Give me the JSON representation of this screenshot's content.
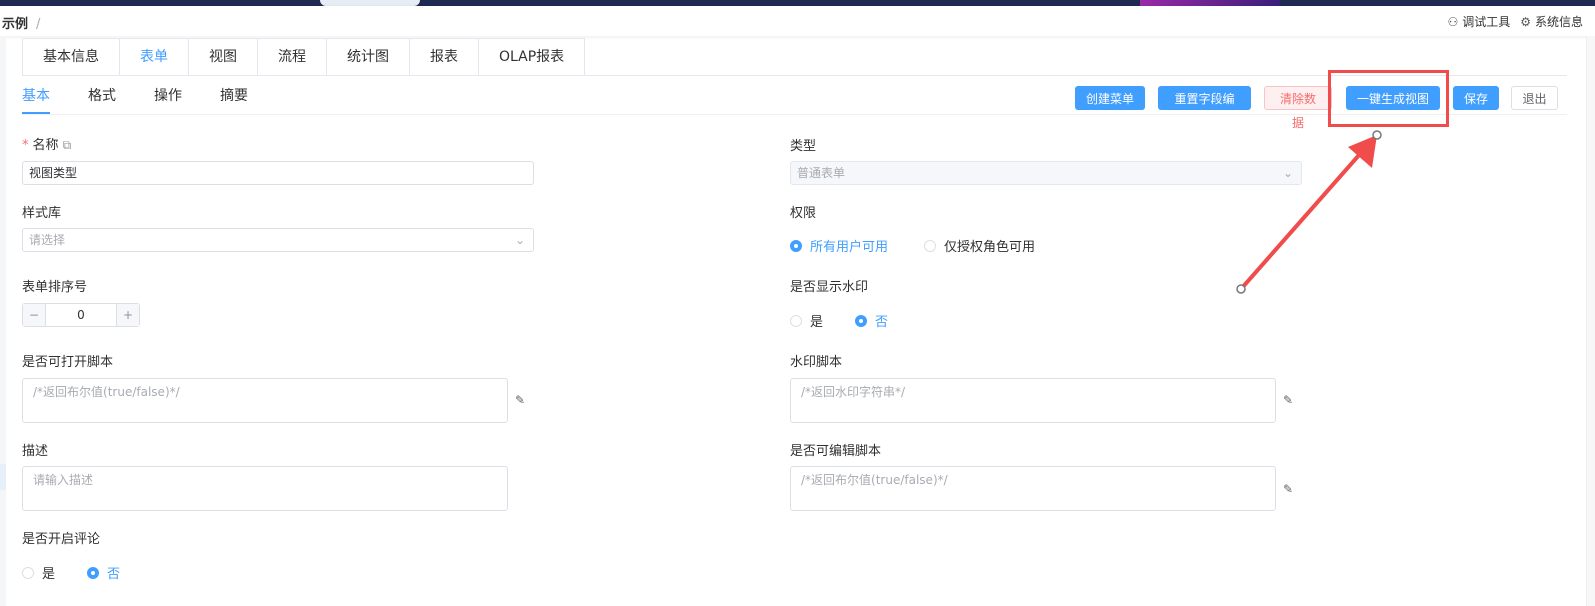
{
  "header": {
    "breadcrumb": "示例",
    "breadcrumb_sep": "/",
    "tools": [
      {
        "icon": "debug-icon",
        "label": "调试工具"
      },
      {
        "icon": "gear-icon",
        "label": "系统信息"
      }
    ]
  },
  "tabs_main": [
    "基本信息",
    "表单",
    "视图",
    "流程",
    "统计图",
    "报表",
    "OLAP报表"
  ],
  "tabs_main_active": "表单",
  "tabs_sub": [
    "基本",
    "格式",
    "操作",
    "摘要"
  ],
  "tabs_sub_active": "基本",
  "buttons": {
    "create_menu": "创建菜单",
    "reset_field_no": "重置字段编号",
    "clear_data": "清除数据",
    "generate_view": "一键生成视图",
    "save": "保存",
    "exit": "退出"
  },
  "form": {
    "name_label": "名称",
    "name_value": "视图类型",
    "style_lib_label": "样式库",
    "style_lib_placeholder": "请选择",
    "sort_label": "表单排序号",
    "sort_value": "0",
    "open_script_label": "是否可打开脚本",
    "open_script_placeholder": "/*返回布尔值(true/false)*/",
    "desc_label": "描述",
    "desc_placeholder": "请输入描述",
    "comment_label": "是否开启评论",
    "comment_options": [
      "是",
      "否"
    ],
    "comment_selected": "否",
    "type_label": "类型",
    "type_value": "普通表单",
    "perm_label": "权限",
    "perm_options": [
      "所有用户可用",
      "仅授权角色可用"
    ],
    "perm_selected": "所有用户可用",
    "watermark_label": "是否显示水印",
    "watermark_options": [
      "是",
      "否"
    ],
    "watermark_selected": "否",
    "watermark_script_label": "水印脚本",
    "watermark_script_placeholder": "/*返回水印字符串*/",
    "edit_script_label": "是否可编辑脚本",
    "edit_script_placeholder": "/*返回布尔值(true/false)*/"
  },
  "colors": {
    "primary": "#409eff",
    "annotation": "#f04c4c"
  }
}
